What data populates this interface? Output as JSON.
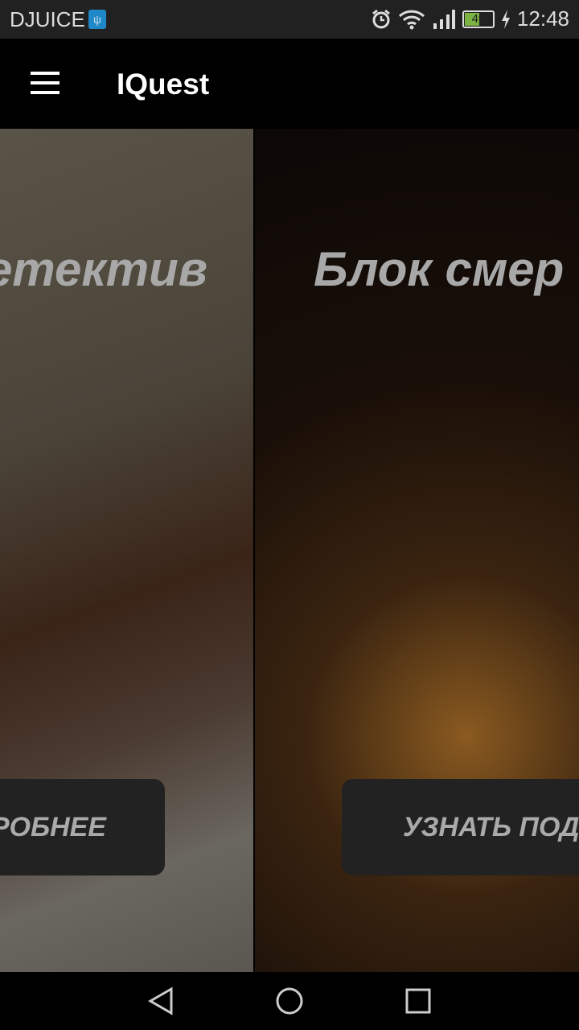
{
  "status": {
    "carrier": "DJUICE",
    "battery": "49",
    "time": "12:48",
    "icons": [
      "usb-icon",
      "alarm-icon",
      "wifi-icon",
      "signal-icon",
      "battery-icon",
      "charging-icon"
    ]
  },
  "appbar": {
    "title": "IQuest"
  },
  "cards": [
    {
      "title": "Детектив",
      "button": "ПОДРОБНЕЕ"
    },
    {
      "title": "Блок смер",
      "button": "УЗНАТЬ ПОДРОБНЕЕ"
    }
  ]
}
